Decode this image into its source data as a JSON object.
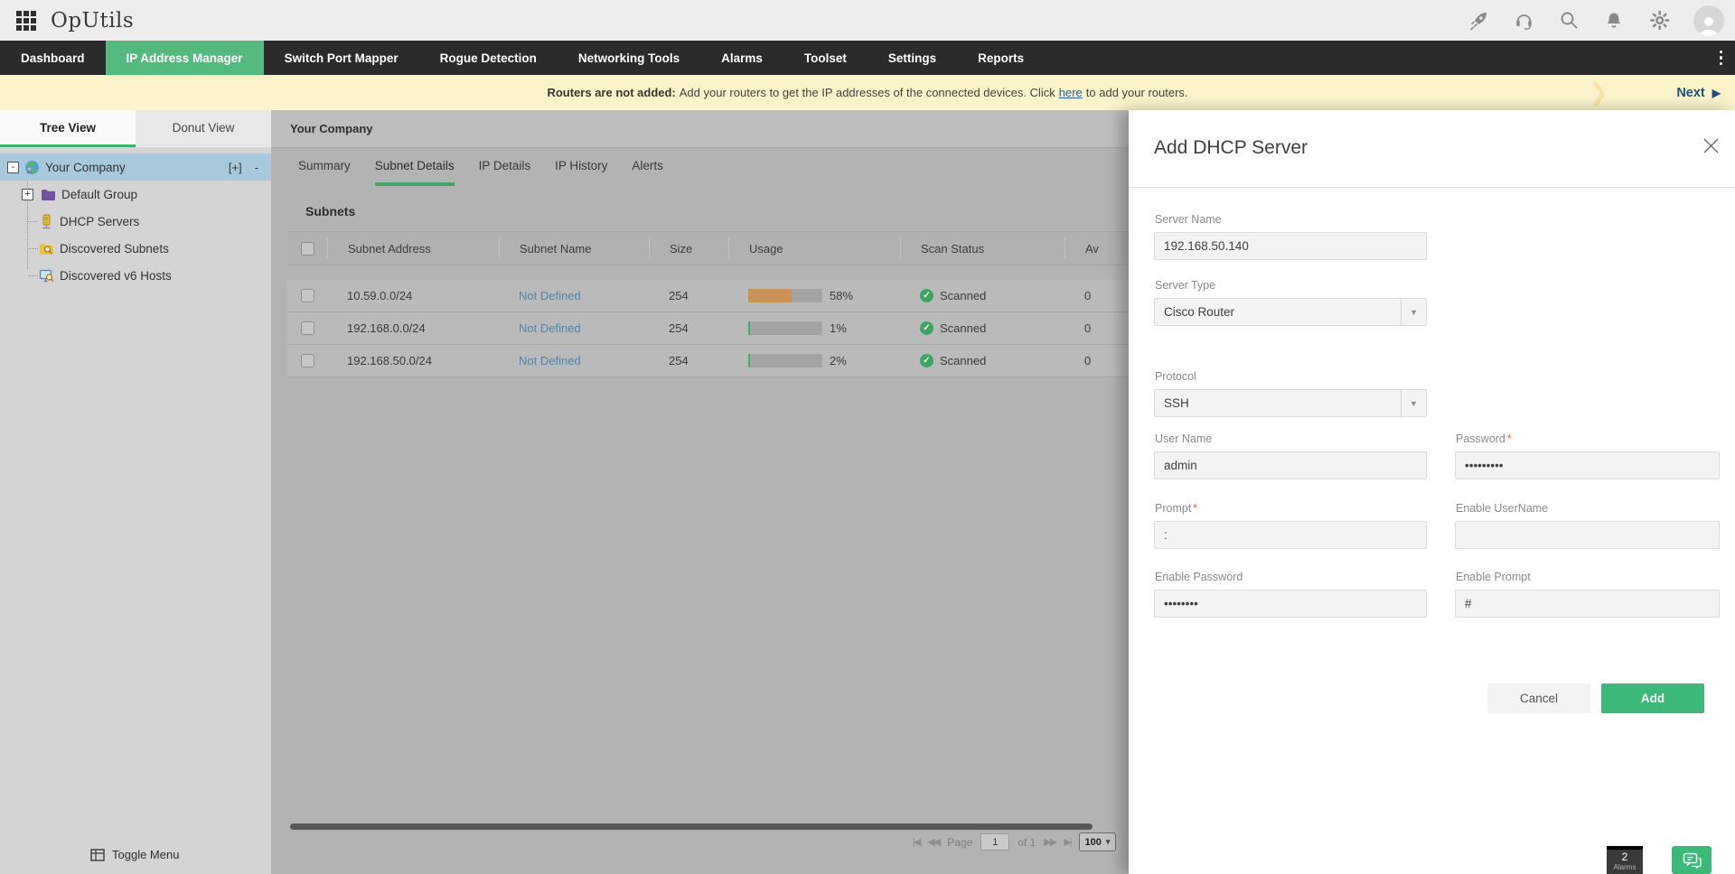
{
  "app": {
    "title": "OpUtils"
  },
  "nav": {
    "items": [
      {
        "label": "Dashboard",
        "active": false
      },
      {
        "label": "IP Address Manager",
        "active": true
      },
      {
        "label": "Switch Port Mapper",
        "active": false
      },
      {
        "label": "Rogue Detection",
        "active": false
      },
      {
        "label": "Networking Tools",
        "active": false
      },
      {
        "label": "Alarms",
        "active": false
      },
      {
        "label": "Toolset",
        "active": false
      },
      {
        "label": "Settings",
        "active": false
      },
      {
        "label": "Reports",
        "active": false
      }
    ]
  },
  "banner": {
    "bold": "Routers are not added:",
    "text_before_link": "Add your routers to get the IP addresses of the connected devices. Click",
    "link": "here",
    "text_after_link": "to add your routers.",
    "next_label": "Next",
    "next_arrow": "▶"
  },
  "sidebar": {
    "tabs": [
      {
        "label": "Tree View",
        "active": true
      },
      {
        "label": "Donut View",
        "active": false
      }
    ],
    "tree": [
      {
        "label": "Your Company",
        "expander": "-",
        "selected": true,
        "add_control": "[+]",
        "remove_control": "-"
      },
      {
        "label": "Default Group",
        "expander": "+"
      },
      {
        "label": "DHCP Servers"
      },
      {
        "label": "Discovered Subnets"
      },
      {
        "label": "Discovered v6 Hosts"
      }
    ],
    "toggle_menu_label": "Toggle Menu"
  },
  "main": {
    "group_title": "Your Company",
    "tabs": [
      {
        "label": "Summary",
        "active": false
      },
      {
        "label": "Subnet Details",
        "active": true
      },
      {
        "label": "IP Details",
        "active": false
      },
      {
        "label": "IP History",
        "active": false
      },
      {
        "label": "Alerts",
        "active": false
      }
    ],
    "section_title": "Subnets",
    "table": {
      "columns": [
        "Subnet Address",
        "Subnet Name",
        "Size",
        "Usage",
        "Scan Status",
        "Av"
      ],
      "rows": [
        {
          "address": "10.59.0.0/24",
          "name": "Not Defined",
          "size": "254",
          "usage_pct": 58,
          "usage_label": "58%",
          "scan_status": "Scanned",
          "trailing": "0"
        },
        {
          "address": "192.168.0.0/24",
          "name": "Not Defined",
          "size": "254",
          "usage_pct": 1,
          "usage_label": "1%",
          "scan_status": "Scanned",
          "trailing": "0"
        },
        {
          "address": "192.168.50.0/24",
          "name": "Not Defined",
          "size": "254",
          "usage_pct": 2,
          "usage_label": "2%",
          "scan_status": "Scanned",
          "trailing": "0"
        }
      ]
    },
    "pagination": {
      "first": "|◀",
      "prev": "◀◀",
      "page_label": "Page",
      "page_value": "1",
      "of_label": "of 1",
      "next": "▶▶",
      "last": "▶|",
      "page_size": "100",
      "caret": "▾"
    }
  },
  "modal": {
    "title": "Add DHCP Server",
    "fields": {
      "server_name": {
        "label": "Server Name",
        "value": "192.168.50.140"
      },
      "server_type": {
        "label": "Server Type",
        "value": "Cisco Router"
      },
      "protocol": {
        "label": "Protocol",
        "value": "SSH"
      },
      "user_name": {
        "label": "User Name",
        "value": "admin"
      },
      "password": {
        "label": "Password",
        "value": "•••••••••",
        "required": "*"
      },
      "prompt": {
        "label": "Prompt",
        "value": ":",
        "required": "*"
      },
      "enable_username": {
        "label": "Enable UserName",
        "value": ""
      },
      "enable_password": {
        "label": "Enable Password",
        "value": "••••••••"
      },
      "enable_prompt": {
        "label": "Enable Prompt",
        "value": "#"
      }
    },
    "cancel_label": "Cancel",
    "add_label": "Add"
  },
  "floating": {
    "alarm_count": "2",
    "alarm_label": "Alarms"
  },
  "colors": {
    "accent_green": "#3cb878",
    "nav_active_green": "#53b97f",
    "usage_orange": "#cb9255",
    "usage_green": "#3fae6e",
    "banner_bg": "#fbf4cb",
    "selected_tree_row": "#a7c9db",
    "link_blue": "#4e87ae"
  }
}
